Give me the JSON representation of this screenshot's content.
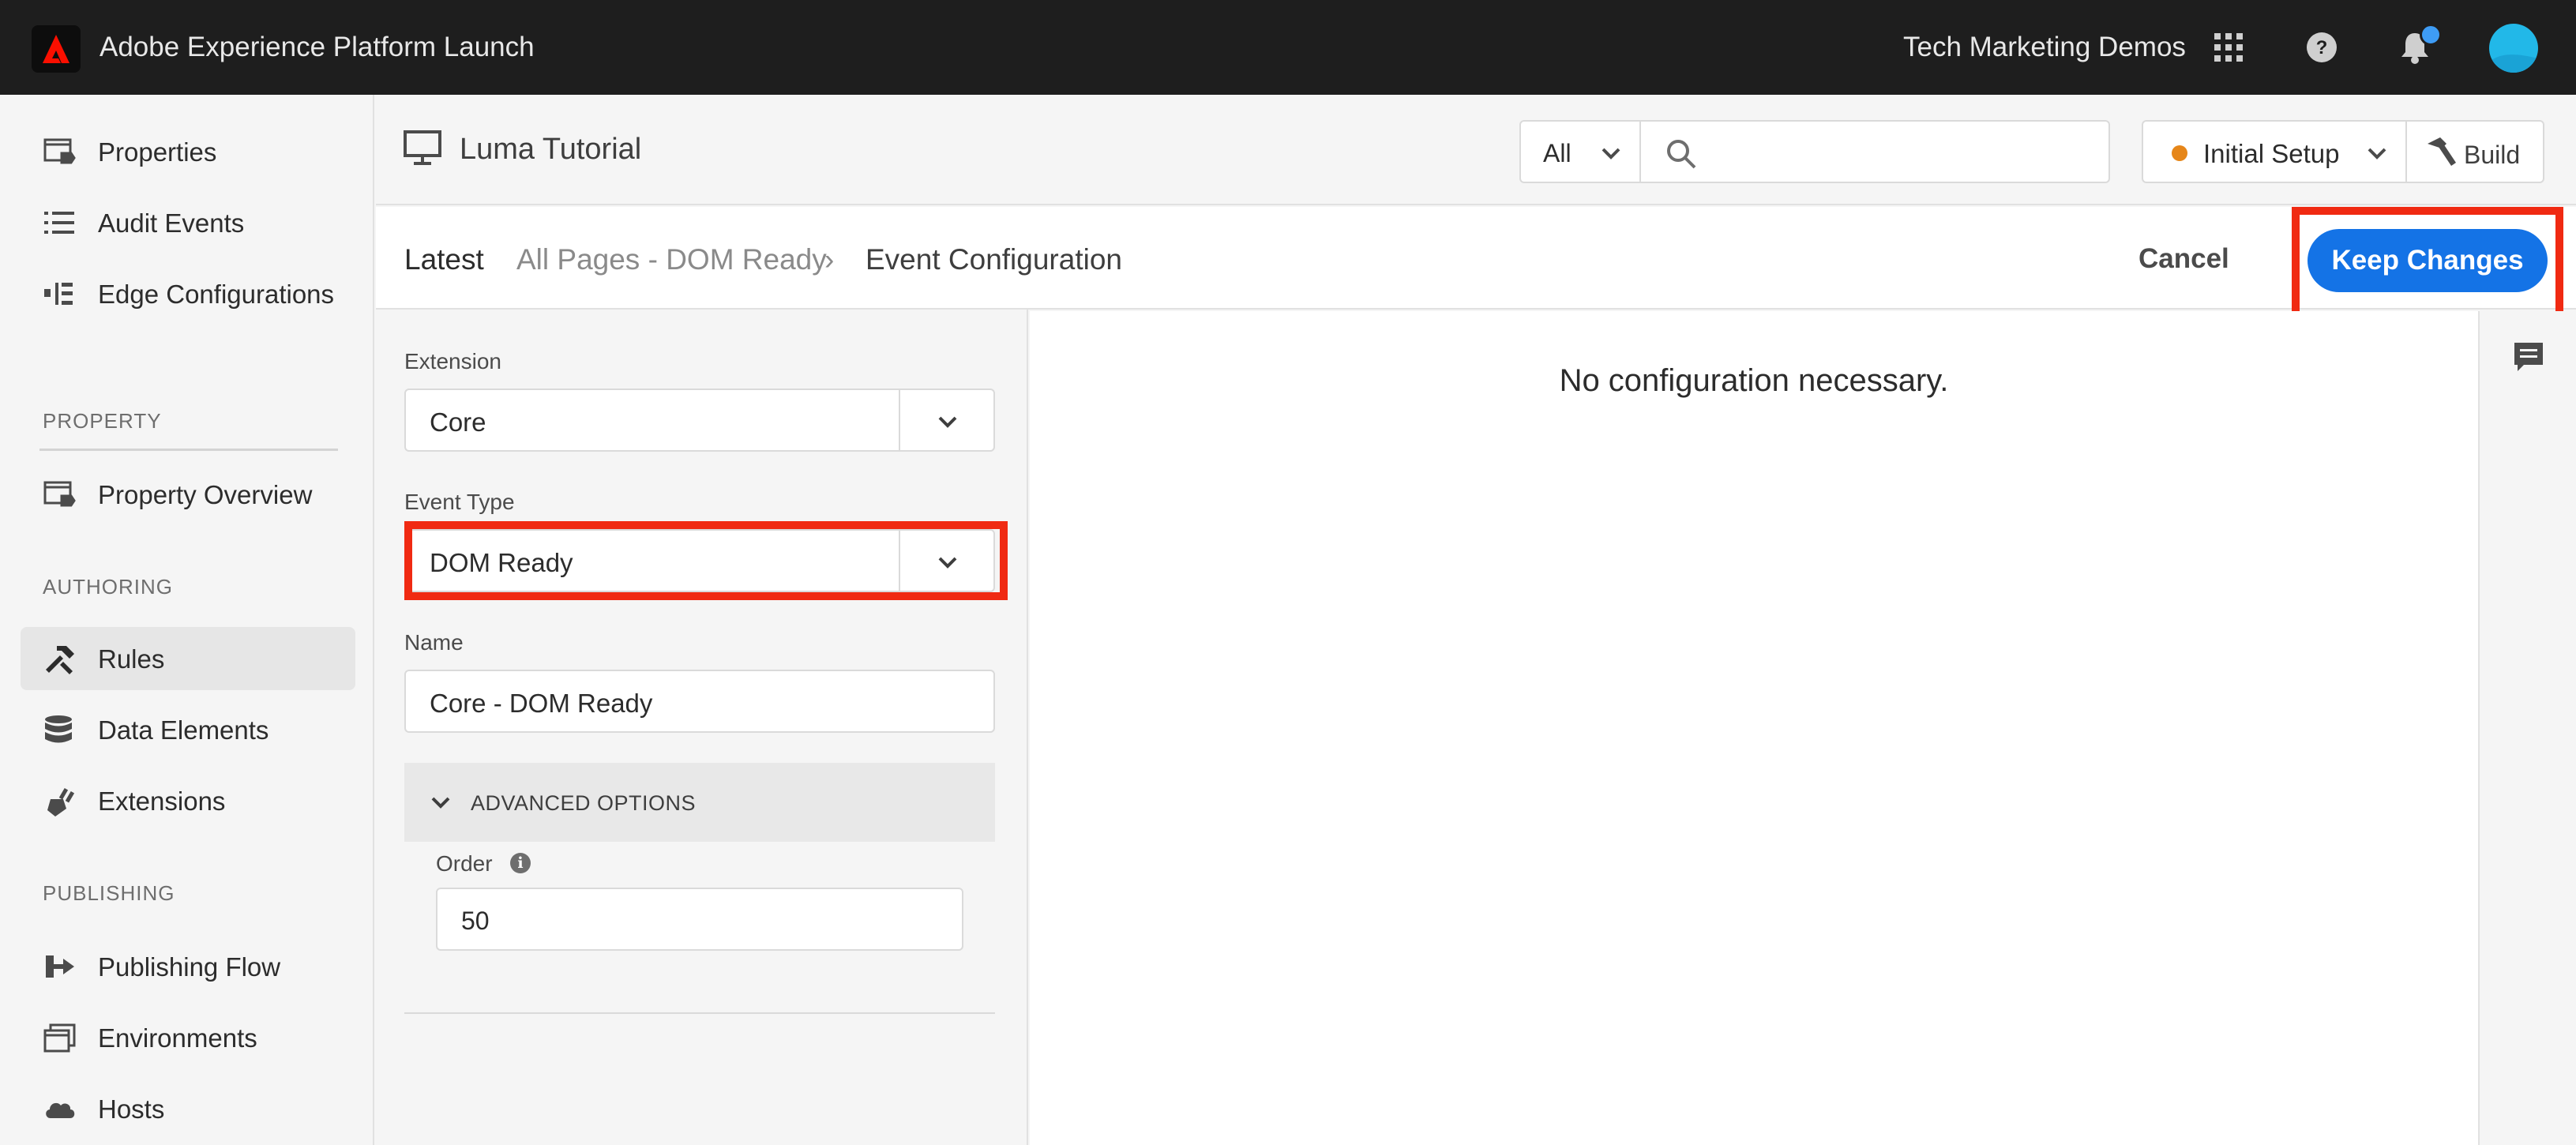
{
  "topbar": {
    "app_title": "Adobe Experience Platform Launch",
    "org_name": "Tech Marketing Demos",
    "icons": [
      "adobe-logo",
      "apps-grid-icon",
      "help-icon",
      "bell-icon",
      "avatar"
    ],
    "notification_dot_color": "#3e9cf5"
  },
  "sidebar": {
    "items": [
      {
        "label": "Properties",
        "icon": "properties-icon"
      },
      {
        "label": "Audit Events",
        "icon": "list-icon"
      },
      {
        "label": "Edge Configurations",
        "icon": "edge-config-icon"
      }
    ],
    "sections": [
      {
        "heading": "PROPERTY",
        "items": [
          {
            "label": "Property Overview",
            "icon": "property-overview-icon"
          }
        ]
      },
      {
        "heading": "AUTHORING",
        "items": [
          {
            "label": "Rules",
            "icon": "rules-icon",
            "active": true
          },
          {
            "label": "Data Elements",
            "icon": "database-icon"
          },
          {
            "label": "Extensions",
            "icon": "plug-icon"
          }
        ]
      },
      {
        "heading": "PUBLISHING",
        "items": [
          {
            "label": "Publishing Flow",
            "icon": "publishing-flow-icon"
          },
          {
            "label": "Environments",
            "icon": "environments-icon"
          },
          {
            "label": "Hosts",
            "icon": "cloud-icon"
          }
        ]
      }
    ]
  },
  "property_header": {
    "property_name": "Luma Tutorial",
    "search_scope": "All",
    "search_value": "",
    "library": "Initial Setup",
    "library_status_color": "#e68619",
    "build_label": "Build"
  },
  "breadcrumb": {
    "items": [
      "Latest",
      "All Pages - DOM Ready",
      "Event Configuration"
    ],
    "separator": "›",
    "cancel_label": "Cancel",
    "keep_label": "Keep Changes"
  },
  "form": {
    "extension_label": "Extension",
    "extension_value": "Core",
    "event_type_label": "Event Type",
    "event_type_value": "DOM Ready",
    "name_label": "Name",
    "name_value": "Core - DOM Ready",
    "advanced_label": "ADVANCED OPTIONS",
    "order_label": "Order",
    "order_info": "i",
    "order_value": "50"
  },
  "config": {
    "message": "No configuration necessary."
  },
  "colors": {
    "accent": "#1473e6",
    "highlight": "#f02a12",
    "topbar": "#1e1e1e"
  }
}
